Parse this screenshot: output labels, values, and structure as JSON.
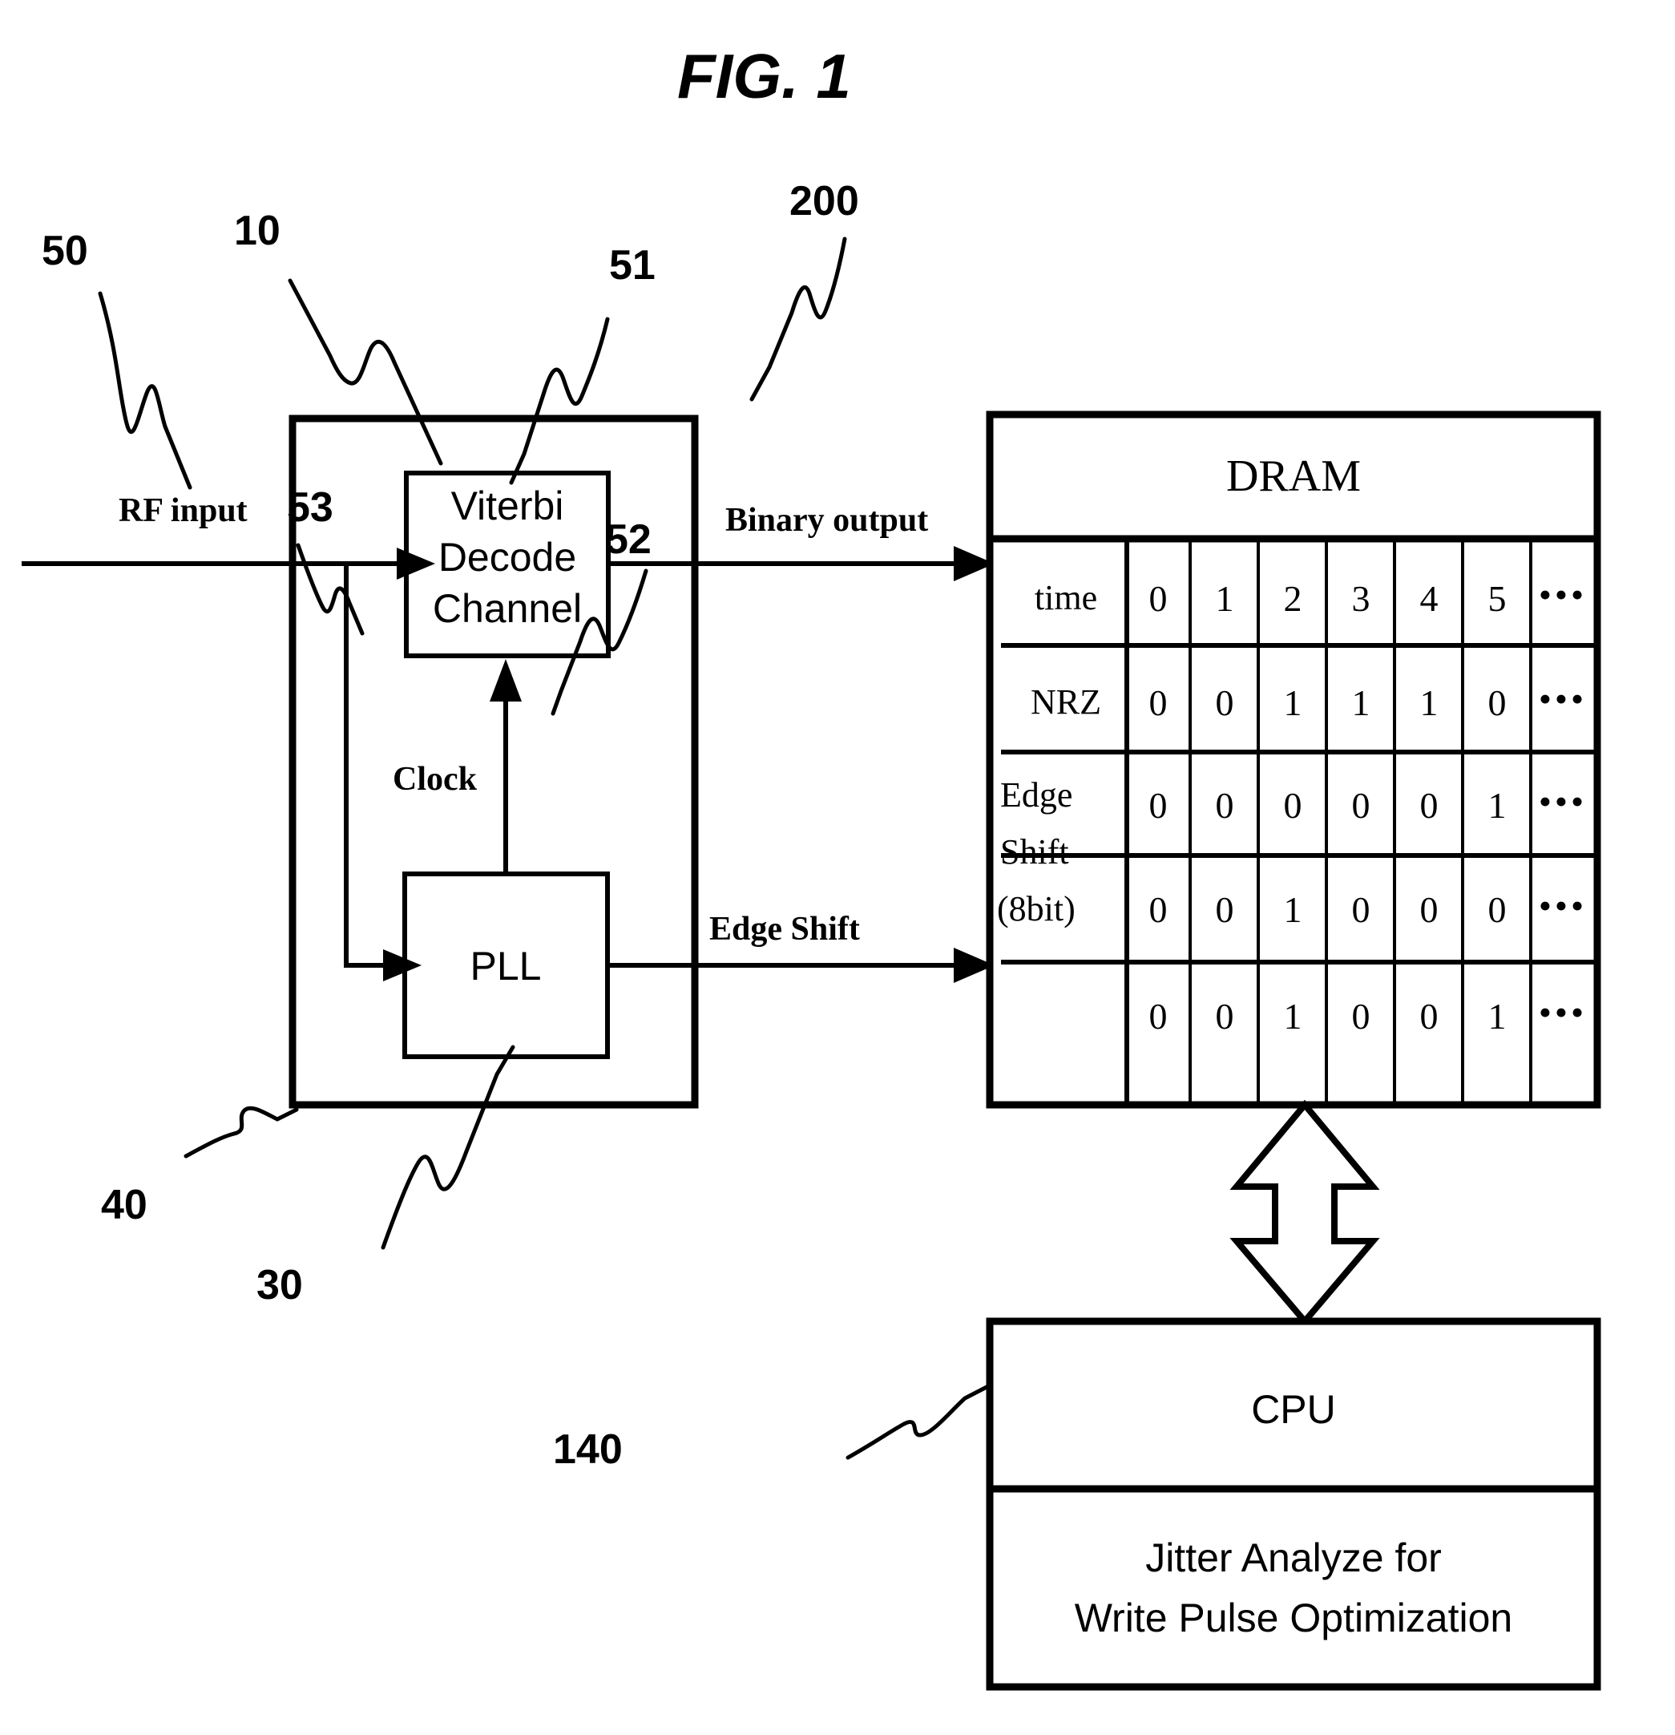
{
  "figure": {
    "title": "FIG. 1"
  },
  "reference_numerals": {
    "rf_input": "50",
    "read_channel": "10",
    "binary_output": "51",
    "dram": "200",
    "clock": "53",
    "edge_shift": "52",
    "outer_block": "40",
    "pll": "30",
    "cpu": "140"
  },
  "signal_labels": {
    "rf_input": "RF input",
    "binary_output": "Binary output",
    "clock": "Clock",
    "edge_shift": "Edge Shift"
  },
  "blocks": {
    "viterbi": {
      "line1": "Viterbi",
      "line2": "Decode",
      "line3": "Channel"
    },
    "pll": {
      "label": "PLL"
    },
    "cpu": {
      "title": "CPU",
      "desc_line1": "Jitter Analyze for",
      "desc_line2": "Write Pulse Optimization"
    },
    "dram": {
      "title": "DRAM"
    }
  },
  "chart_data": {
    "type": "table",
    "title": "DRAM",
    "row_headers": [
      "time",
      "NRZ",
      "Edge Shift (8bit)"
    ],
    "columns": [
      "0",
      "1",
      "2",
      "3",
      "4",
      "5",
      "•••"
    ],
    "rows": [
      {
        "header": "time",
        "values": [
          "0",
          "1",
          "2",
          "3",
          "4",
          "5",
          "•••"
        ]
      },
      {
        "header": "NRZ",
        "values": [
          "0",
          "0",
          "1",
          "1",
          "1",
          "0",
          "•••"
        ]
      },
      {
        "header": "",
        "values": [
          "0",
          "0",
          "0",
          "0",
          "0",
          "1",
          "•••"
        ]
      },
      {
        "header": "Edge Shift (8bit)",
        "values": [
          "0",
          "0",
          "1",
          "0",
          "0",
          "0",
          "•••"
        ]
      },
      {
        "header": "",
        "values": [
          "0",
          "0",
          "1",
          "0",
          "0",
          "1",
          "•••"
        ]
      }
    ],
    "edge_shift_label_lines": [
      "Edge",
      "Shift",
      "(8bit)"
    ]
  },
  "colors": {
    "ink": "#000000",
    "paper": "#ffffff"
  }
}
